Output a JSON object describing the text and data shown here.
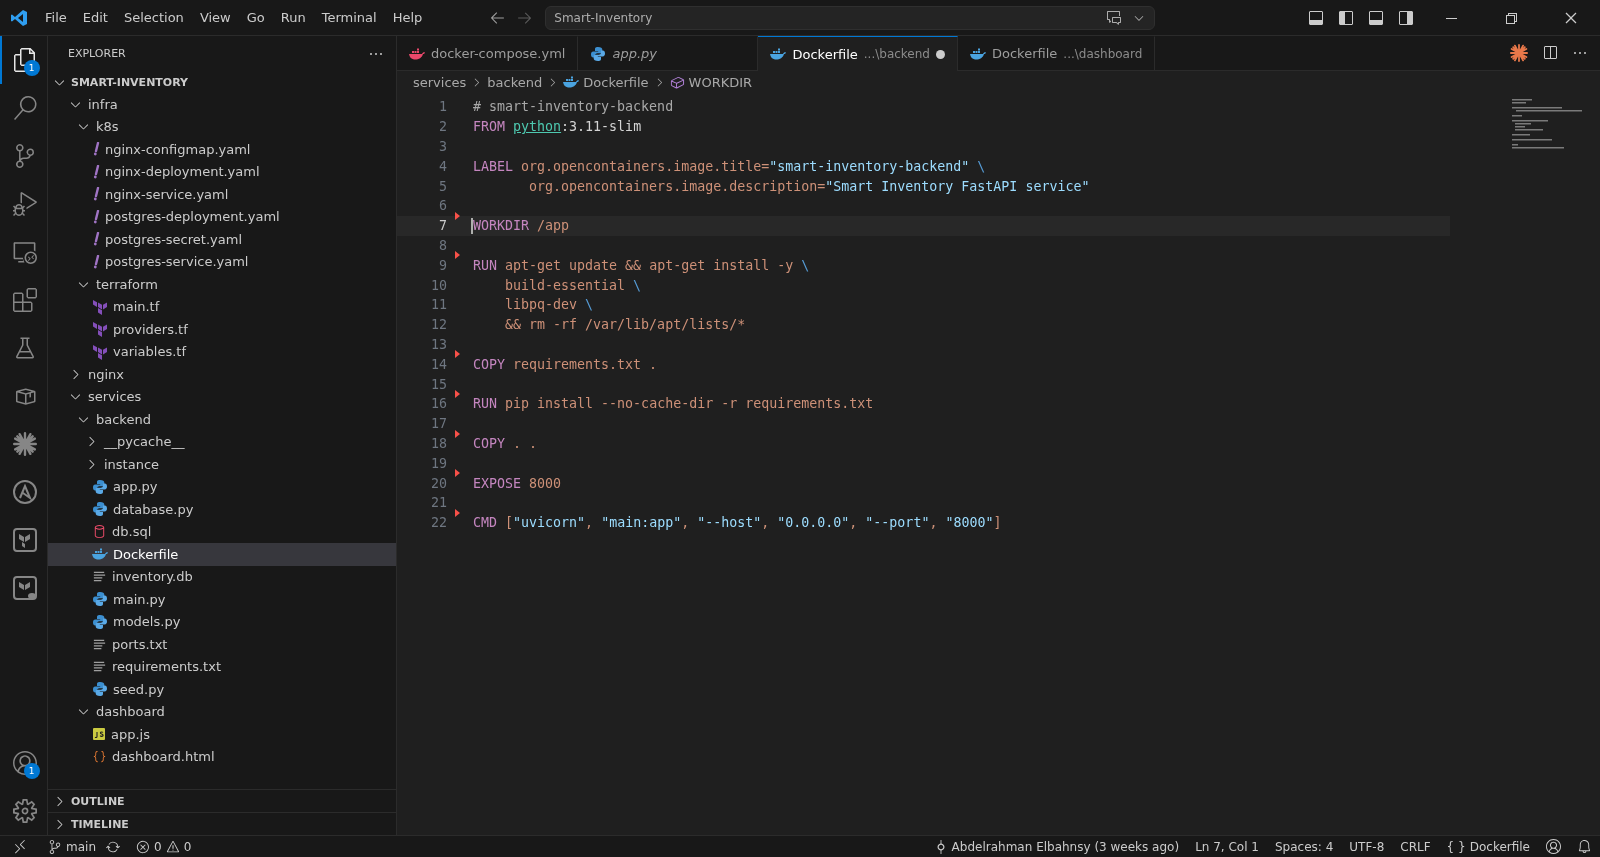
{
  "menu": [
    "File",
    "Edit",
    "Selection",
    "View",
    "Go",
    "Run",
    "Terminal",
    "Help"
  ],
  "command_center": {
    "value": "Smart-Inventory"
  },
  "activity_bar": [
    {
      "kind": "explorer",
      "selected": true,
      "badge": "1"
    },
    {
      "kind": "search",
      "selected": false
    },
    {
      "kind": "scm",
      "selected": false
    },
    {
      "kind": "debug",
      "selected": false
    },
    {
      "kind": "remote",
      "selected": false
    },
    {
      "kind": "extensions",
      "selected": false
    },
    {
      "kind": "testing",
      "selected": false
    },
    {
      "kind": "containers",
      "selected": false
    },
    {
      "kind": "spark",
      "selected": false
    },
    {
      "kind": "ansible",
      "selected": false
    },
    {
      "kind": "terraform",
      "selected": false
    },
    {
      "kind": "terraform-cloud",
      "selected": false
    }
  ],
  "activity_bottom": [
    {
      "kind": "accounts",
      "badge": "1"
    },
    {
      "kind": "settings"
    }
  ],
  "sidebar": {
    "title": "EXPLORER",
    "root": "SMART-INVENTORY",
    "tree": [
      {
        "name": "infra",
        "kind": "folder",
        "expanded": true,
        "selected": false,
        "children": [
          {
            "name": "k8s",
            "kind": "folder",
            "expanded": true,
            "selected": false,
            "children": [
              {
                "name": "nginx-configmap.yaml",
                "kind": "yaml",
                "selected": false
              },
              {
                "name": "nginx-deployment.yaml",
                "kind": "yaml",
                "selected": false
              },
              {
                "name": "nginx-service.yaml",
                "kind": "yaml",
                "selected": false
              },
              {
                "name": "postgres-deployment.yaml",
                "kind": "yaml",
                "selected": false
              },
              {
                "name": "postgres-secret.yaml",
                "kind": "yaml",
                "selected": false
              },
              {
                "name": "postgres-service.yaml",
                "kind": "yaml",
                "selected": false
              }
            ]
          },
          {
            "name": "terraform",
            "kind": "folder",
            "expanded": true,
            "selected": false,
            "children": [
              {
                "name": "main.tf",
                "kind": "tf",
                "selected": false
              },
              {
                "name": "providers.tf",
                "kind": "tf",
                "selected": false
              },
              {
                "name": "variables.tf",
                "kind": "tf",
                "selected": false
              }
            ]
          }
        ]
      },
      {
        "name": "nginx",
        "kind": "folder",
        "expanded": false,
        "selected": false
      },
      {
        "name": "services",
        "kind": "folder",
        "expanded": true,
        "selected": false,
        "children": [
          {
            "name": "backend",
            "kind": "folder",
            "expanded": true,
            "selected": false,
            "children": [
              {
                "name": "__pycache__",
                "kind": "folder",
                "expanded": false,
                "selected": false
              },
              {
                "name": "instance",
                "kind": "folder",
                "expanded": false,
                "selected": false
              },
              {
                "name": "app.py",
                "kind": "py",
                "selected": false
              },
              {
                "name": "database.py",
                "kind": "py",
                "selected": false
              },
              {
                "name": "db.sql",
                "kind": "sql",
                "selected": false
              },
              {
                "name": "Dockerfile",
                "kind": "docker",
                "selected": true
              },
              {
                "name": "inventory.db",
                "kind": "text",
                "selected": false
              },
              {
                "name": "main.py",
                "kind": "py",
                "selected": false
              },
              {
                "name": "models.py",
                "kind": "py",
                "selected": false
              },
              {
                "name": "ports.txt",
                "kind": "text",
                "selected": false
              },
              {
                "name": "requirements.txt",
                "kind": "text",
                "selected": false
              },
              {
                "name": "seed.py",
                "kind": "py",
                "selected": false
              }
            ]
          },
          {
            "name": "dashboard",
            "kind": "folder",
            "expanded": true,
            "selected": false,
            "children": [
              {
                "name": "app.js",
                "kind": "js",
                "selected": false
              },
              {
                "name": "dashboard.html",
                "kind": "html",
                "selected": false
              }
            ]
          }
        ]
      }
    ],
    "sections": [
      {
        "title": "OUTLINE",
        "expanded": false
      },
      {
        "title": "TIMELINE",
        "expanded": false
      }
    ]
  },
  "tabs": [
    {
      "label": "docker-compose.yml",
      "kind": "compose",
      "selected": false,
      "preview": false
    },
    {
      "label": "app.py",
      "kind": "py",
      "selected": false,
      "preview": true
    },
    {
      "label": "Dockerfile",
      "path": "...\\backend",
      "kind": "docker",
      "selected": true,
      "preview": false,
      "modified": true
    },
    {
      "label": "Dockerfile",
      "path": "...\\dashboard",
      "kind": "docker",
      "selected": false,
      "preview": false
    }
  ],
  "breadcrumbs": [
    {
      "label": "services",
      "kind": "folder"
    },
    {
      "label": "backend",
      "kind": "folder"
    },
    {
      "label": "Dockerfile",
      "kind": "docker"
    },
    {
      "label": "WORKDIR",
      "kind": "symbol"
    }
  ],
  "code": [
    {
      "n": "1",
      "tokens": [
        {
          "t": "# smart-inventory-backend",
          "kind": "comment"
        }
      ]
    },
    {
      "n": "2",
      "tokens": [
        {
          "t": "FROM ",
          "kind": "kw"
        },
        {
          "t": "python",
          "kind": "image"
        },
        {
          "t": ":3.11-slim",
          "kind": "plain"
        }
      ]
    },
    {
      "n": "3"
    },
    {
      "n": "4",
      "tokens": [
        {
          "t": "LABEL ",
          "kind": "kw"
        },
        {
          "t": "org.opencontainers.image.title=",
          "kind": "arg"
        },
        {
          "t": "\"smart-inventory-backend\"",
          "kind": "str"
        },
        {
          "t": " \\",
          "kind": "op"
        }
      ]
    },
    {
      "n": "5",
      "tokens": [
        {
          "t": "       org.opencontainers.image.description=",
          "kind": "arg"
        },
        {
          "t": "\"Smart Inventory FastAPI service\"",
          "kind": "str"
        }
      ]
    },
    {
      "n": "6"
    },
    {
      "n": "7",
      "current": true,
      "git_mark": true,
      "tokens": [
        {
          "t": "WORKDIR ",
          "kind": "kw"
        },
        {
          "t": "/app",
          "kind": "arg"
        }
      ]
    },
    {
      "n": "8"
    },
    {
      "n": "9",
      "git_mark": true,
      "tokens": [
        {
          "t": "RUN ",
          "kind": "kw"
        },
        {
          "t": "apt-get update && apt-get install -y",
          "kind": "arg"
        },
        {
          "t": " \\",
          "kind": "op"
        }
      ]
    },
    {
      "n": "10",
      "tokens": [
        {
          "t": "    build-essential",
          "kind": "arg"
        },
        {
          "t": " \\",
          "kind": "op"
        }
      ]
    },
    {
      "n": "11",
      "tokens": [
        {
          "t": "    libpq-dev",
          "kind": "arg"
        },
        {
          "t": " \\",
          "kind": "op"
        }
      ]
    },
    {
      "n": "12",
      "tokens": [
        {
          "t": "    && rm -rf /var/lib/apt/lists/*",
          "kind": "arg"
        }
      ]
    },
    {
      "n": "13"
    },
    {
      "n": "14",
      "git_mark": true,
      "tokens": [
        {
          "t": "COPY ",
          "kind": "kw"
        },
        {
          "t": "requirements.txt .",
          "kind": "arg"
        }
      ]
    },
    {
      "n": "15"
    },
    {
      "n": "16",
      "git_mark": true,
      "tokens": [
        {
          "t": "RUN ",
          "kind": "kw"
        },
        {
          "t": "pip install --no-cache-dir -r requirements.txt",
          "kind": "arg"
        }
      ]
    },
    {
      "n": "17"
    },
    {
      "n": "18",
      "git_mark": true,
      "tokens": [
        {
          "t": "COPY ",
          "kind": "kw"
        },
        {
          "t": ". .",
          "kind": "arg"
        }
      ]
    },
    {
      "n": "19"
    },
    {
      "n": "20",
      "git_mark": true,
      "tokens": [
        {
          "t": "EXPOSE ",
          "kind": "kw"
        },
        {
          "t": "8000",
          "kind": "arg"
        }
      ]
    },
    {
      "n": "21"
    },
    {
      "n": "22",
      "git_mark": true,
      "tokens": [
        {
          "t": "CMD ",
          "kind": "kw"
        },
        {
          "t": "[",
          "kind": "arg"
        },
        {
          "t": "\"uvicorn\"",
          "kind": "str"
        },
        {
          "t": ", ",
          "kind": "arg"
        },
        {
          "t": "\"main:app\"",
          "kind": "str"
        },
        {
          "t": ", ",
          "kind": "arg"
        },
        {
          "t": "\"--host\"",
          "kind": "str"
        },
        {
          "t": ", ",
          "kind": "arg"
        },
        {
          "t": "\"0.0.0.0\"",
          "kind": "str"
        },
        {
          "t": ", ",
          "kind": "arg"
        },
        {
          "t": "\"--port\"",
          "kind": "str"
        },
        {
          "t": ", ",
          "kind": "arg"
        },
        {
          "t": "\"8000\"",
          "kind": "str"
        },
        {
          "t": "]",
          "kind": "arg"
        }
      ]
    }
  ],
  "status_bar": {
    "branch": "main",
    "errors": "0",
    "warnings": "0",
    "blame": "Abdelrahman Elbahnsy (3 weeks ago)",
    "position": "Ln 7, Col 1",
    "indent": "Spaces: 4",
    "encoding": "UTF-8",
    "eol": "CRLF",
    "language_icon": "{ }",
    "language": "Dockerfile"
  }
}
